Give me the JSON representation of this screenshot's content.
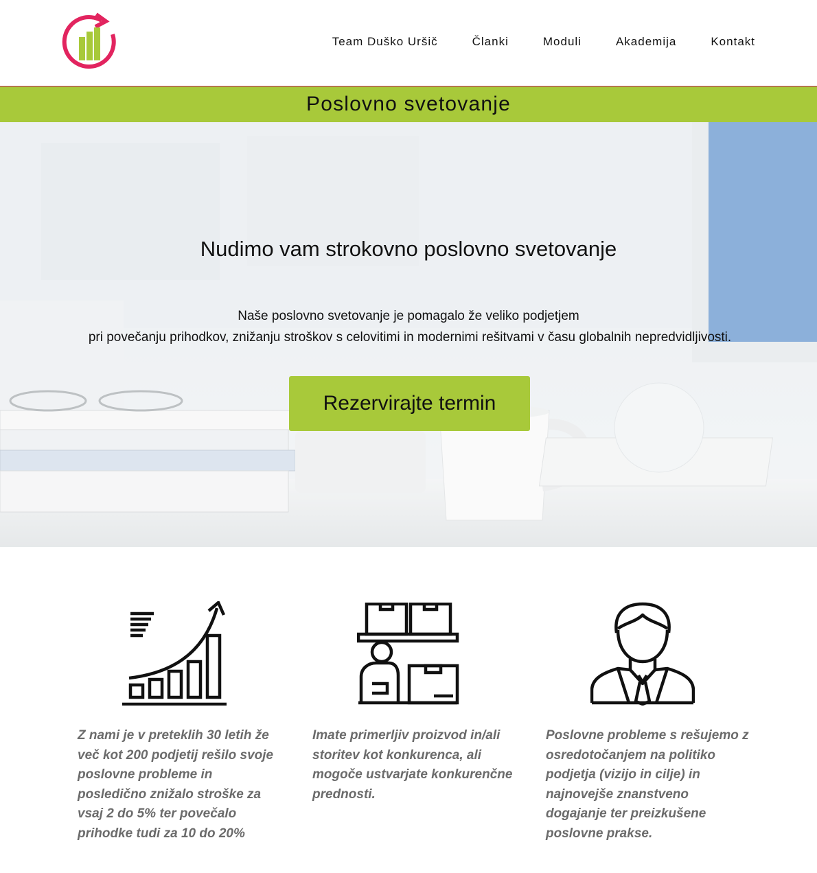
{
  "header": {
    "logo": {
      "icon": "growth-chart-logo-icon",
      "ring_color": "#e2245f",
      "bars_color": "#a8c93a"
    },
    "nav": [
      {
        "label": "Team Duško Uršič"
      },
      {
        "label": "Članki"
      },
      {
        "label": "Moduli"
      },
      {
        "label": "Akademija"
      },
      {
        "label": "Kontakt"
      }
    ]
  },
  "titlebar": {
    "title": "Poslovno svetovanje",
    "color": "#a8c93a"
  },
  "hero": {
    "heading": "Nudimo vam strokovno poslovno svetovanje",
    "line1": "Naše poslovno svetovanje je pomagalo že veliko podjetjem",
    "line2": "pri povečanju prihodkov, znižanju stroškov s celovitimi in modernimi rešitvami v času globalnih nepredvidljivosti.",
    "cta_label": "Rezervirajte termin"
  },
  "features": [
    {
      "icon": "growth-chart-icon",
      "text": "Z nami je v preteklih 30 letih že več kot 200 podjetij rešilo svoje poslovne probleme in posledično znižalo stroške za vsaj 2 do 5% ter povečalo prihodke tudi za 10 do 20%"
    },
    {
      "icon": "warehouse-worker-icon",
      "text": "Imate primerljiv proizvod in/ali storitev kot konkurenca, ali mogoče ustvarjate konkurenčne prednosti."
    },
    {
      "icon": "businessman-icon",
      "text": "Poslovne probleme s rešujemo z osredotočanjem na politiko podjetja (vizijo in cilje) in najnovejše znanstveno dogajanje ter preizkušene poslovne prakse."
    }
  ]
}
